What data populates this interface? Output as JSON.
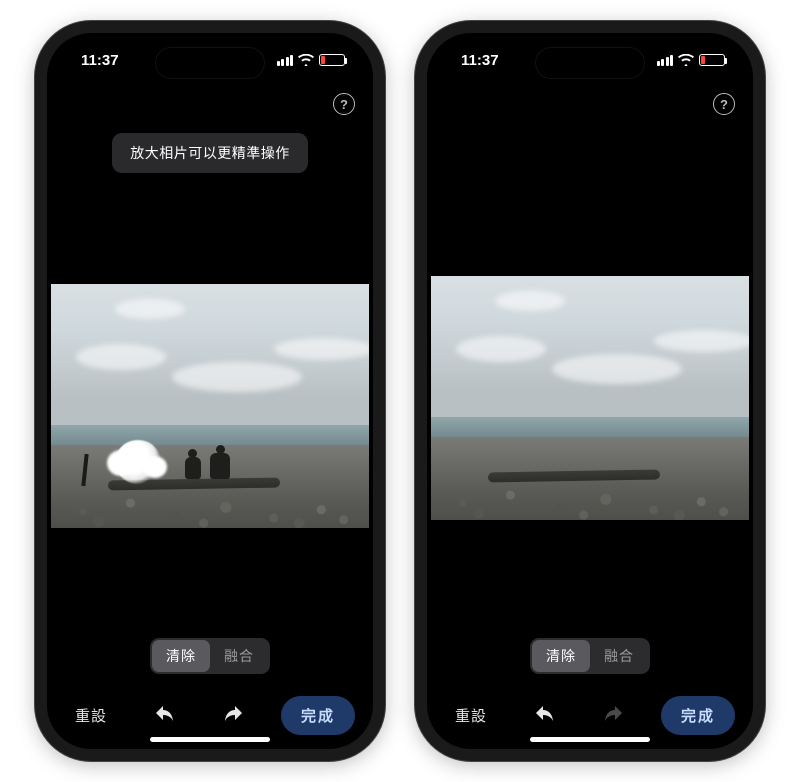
{
  "phones": [
    {
      "status": {
        "time": "11:37",
        "battery_pct": 18
      },
      "tooltip": "放大相片可以更精準操作",
      "show_tooltip": true,
      "photo": {
        "has_people": true,
        "has_erase_mark": true
      },
      "segmented": {
        "erase": "清除",
        "blend": "融合",
        "active": "erase"
      },
      "toolbar": {
        "reset": "重設",
        "undo_enabled": true,
        "redo_enabled": true,
        "done": "完成"
      }
    },
    {
      "status": {
        "time": "11:37",
        "battery_pct": 18
      },
      "tooltip": "",
      "show_tooltip": false,
      "photo": {
        "has_people": false,
        "has_erase_mark": false
      },
      "segmented": {
        "erase": "清除",
        "blend": "融合",
        "active": "erase"
      },
      "toolbar": {
        "reset": "重設",
        "undo_enabled": true,
        "redo_enabled": false,
        "done": "完成"
      }
    }
  ],
  "icons": {
    "help": "?",
    "undo": "↶",
    "redo": "↷"
  }
}
